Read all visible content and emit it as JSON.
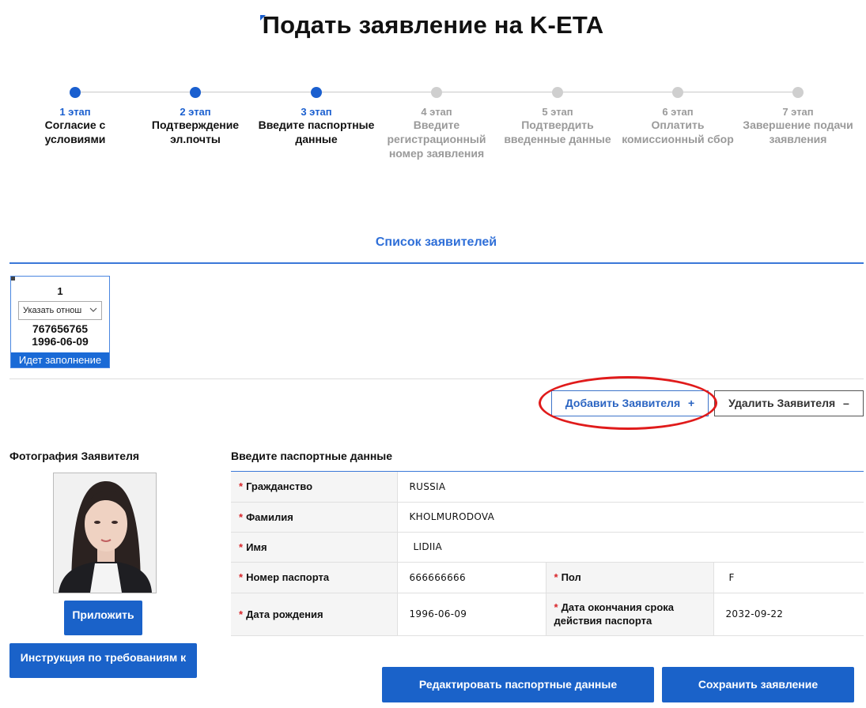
{
  "page": {
    "title": "Подать заявление на K-ETA"
  },
  "steps": [
    {
      "num": "1 этап",
      "label": "Согласие с условиями",
      "active": true
    },
    {
      "num": "2 этап",
      "label": "Подтверждение эл.почты",
      "active": true
    },
    {
      "num": "3 этап",
      "label": "Введите паспортные данные",
      "active": true
    },
    {
      "num": "4 этап",
      "label": "Введите регистрационный номер заявления",
      "active": false
    },
    {
      "num": "5 этап",
      "label": "Подтвердить введенные данные",
      "active": false
    },
    {
      "num": "6 этап",
      "label": "Оплатить комиссионный сбор",
      "active": false
    },
    {
      "num": "7 этап",
      "label": "Завершение подачи заявления",
      "active": false
    }
  ],
  "applicants": {
    "title": "Список заявителей",
    "cards": [
      {
        "index": "1",
        "relation_placeholder": "Указать отнош",
        "passport_number": "767656765",
        "birth_date": "1996-06-09",
        "status": "Идет заполнение"
      }
    ],
    "add_label": "Добавить Заявителя",
    "add_icon": "+",
    "delete_label": "Удалить Заявителя",
    "delete_icon": "–"
  },
  "photo": {
    "title": "Фотография Заявителя",
    "attach_label": "Приложить",
    "guide_label": "Инструкция по требованиям к"
  },
  "passport": {
    "title": "Введите паспортные данные",
    "citizenship_label": "Гражданство",
    "citizenship_value": "RUSSIA",
    "surname_label": "Фамилия",
    "surname_value": "KHOLMURODOVA",
    "name_label": "Имя",
    "name_value": "LIDIIA",
    "passport_no_label": "Номер паспорта",
    "passport_no_value": "666666666",
    "sex_label": "Пол",
    "sex_value": "F",
    "birth_label": "Дата рождения",
    "birth_value": "1996-06-09",
    "expiry_label": "Дата окончания срока действия паспорта",
    "expiry_value": "2032-09-22"
  },
  "actions": {
    "edit_label": "Редактировать паспортные данные",
    "save_label": "Сохранить заявление"
  },
  "colors": {
    "accent": "#1a62c9",
    "highlight": "#e01b1b",
    "inactive": "#cfcfcf"
  }
}
